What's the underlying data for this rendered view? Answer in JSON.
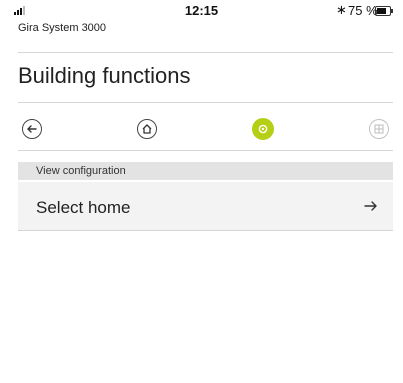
{
  "status_bar": {
    "time": "12:15",
    "battery": "75 %",
    "battery_level": 0.75
  },
  "app": {
    "title": "Gira System 3000"
  },
  "header": {
    "title": "Building functions"
  },
  "nav": [
    {
      "name": "back",
      "icon": "arrow-left-icon",
      "state": "normal"
    },
    {
      "name": "home",
      "icon": "home-icon",
      "state": "normal"
    },
    {
      "name": "settings",
      "icon": "gear-icon",
      "state": "active"
    },
    {
      "name": "grid",
      "icon": "grid-icon",
      "state": "inactive"
    }
  ],
  "section": {
    "header": "View configuration"
  },
  "list": [
    {
      "label": "Select home",
      "icon": "arrow-right-icon"
    }
  ],
  "colors": {
    "accent": "#b5cf17",
    "section_bg": "#e3e3e3",
    "row_bg": "#f3f3f3"
  }
}
